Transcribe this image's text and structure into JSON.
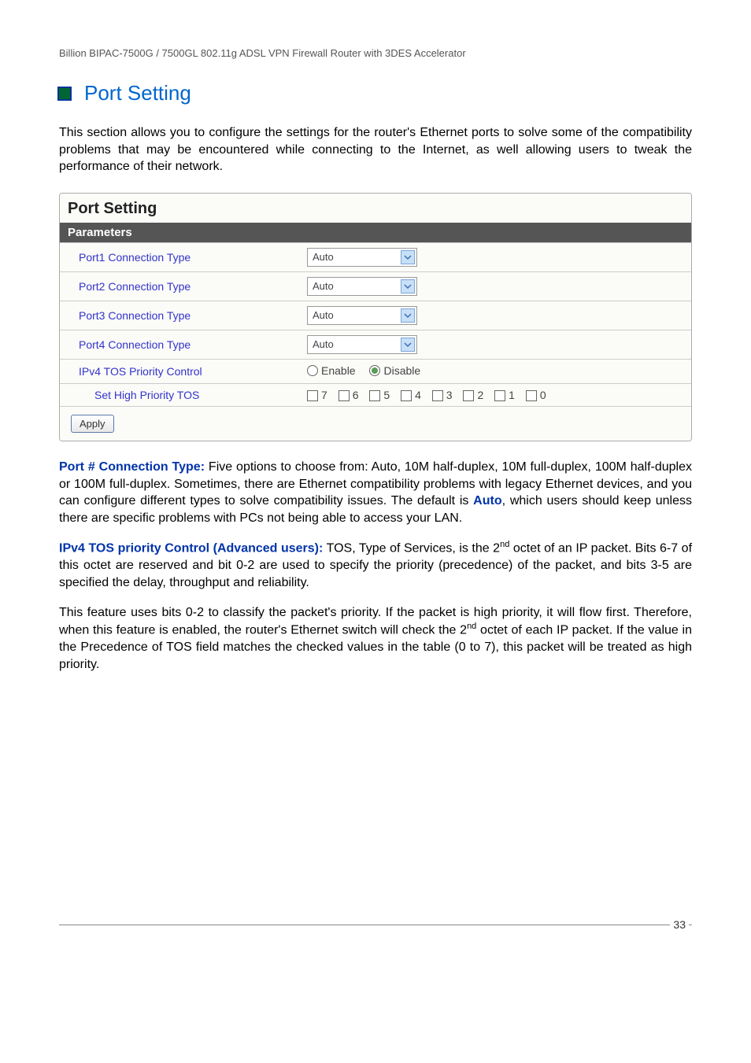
{
  "header": "Billion BIPAC-7500G / 7500GL 802.11g ADSL VPN Firewall Router with 3DES Accelerator",
  "section_title": "Port Setting",
  "intro": "This section allows you to configure the settings for the router's Ethernet ports to solve some of the compatibility problems that may be encountered while connecting to the Internet, as well allowing users to tweak the performance of their network.",
  "box": {
    "title": "Port Setting",
    "subhead": "Parameters",
    "rows": [
      {
        "label": "Port1 Connection Type",
        "value": "Auto"
      },
      {
        "label": "Port2 Connection Type",
        "value": "Auto"
      },
      {
        "label": "Port3 Connection Type",
        "value": "Auto"
      },
      {
        "label": "Port4 Connection Type",
        "value": "Auto"
      }
    ],
    "ipv4_label": "IPv4 TOS Priority Control",
    "enable_label": "Enable",
    "disable_label": "Disable",
    "set_label": "Set High Priority TOS",
    "tos_values": [
      "7",
      "6",
      "5",
      "4",
      "3",
      "2",
      "1",
      "0"
    ],
    "apply": "Apply"
  },
  "paras": {
    "p1_lead": "Port # Connection Type:",
    "p1_body_a": " Five options to choose from: Auto, 10M half-duplex, 10M full-duplex, 100M half-duplex or 100M full-duplex. Sometimes, there are Ethernet compatibility problems with legacy Ethernet devices, and you can configure different types to solve compatibility issues. The default is ",
    "p1_bold": "Auto",
    "p1_body_b": ", which users should keep unless there are specific problems with PCs not being able to access your LAN.",
    "p2_lead": "IPv4 TOS priority Control (Advanced users):",
    "p2_body_a": " TOS, Type of Services, is the 2",
    "p2_sup": "nd",
    "p2_body_b": " octet of an IP packet. Bits 6-7 of this octet are reserved and bit 0-2 are used to specify the priority (precedence) of the packet, and bits 3-5 are specified the delay, throughput and reliability.",
    "p3_a": "This feature uses bits 0-2 to classify the packet's priority. If the packet is high priority, it will flow first.  Therefore, when this feature is enabled, the router's Ethernet switch will check the 2",
    "p3_sup": "nd",
    "p3_b": " octet of each IP packet. If the value in the Precedence of TOS field matches the checked values in the table (0 to 7), this packet will be treated as high priority."
  },
  "page_number": "33"
}
